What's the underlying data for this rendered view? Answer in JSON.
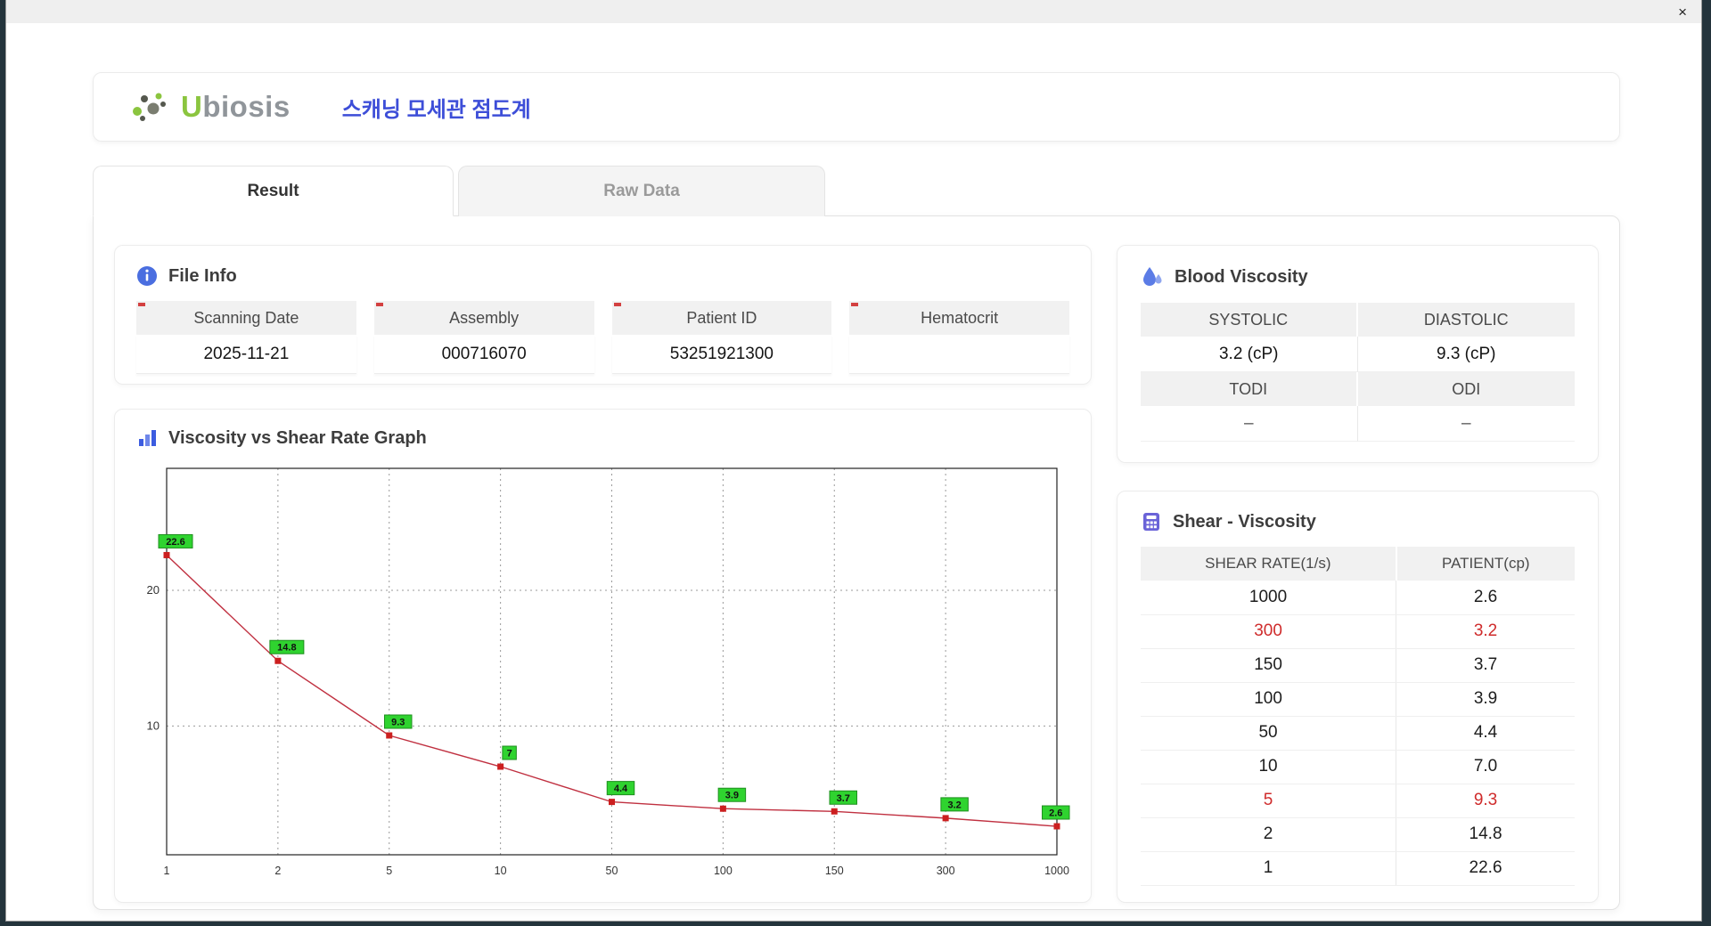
{
  "window": {
    "close_label": "×"
  },
  "header": {
    "logo_first": "U",
    "logo_rest": "biosis",
    "title": "스캐닝 모세관 점도계"
  },
  "tabs": [
    {
      "label": "Result",
      "active": true
    },
    {
      "label": "Raw Data",
      "active": false
    }
  ],
  "icons": {
    "logo": "dots-logo-icon",
    "close": "close-icon",
    "file_info": "info-icon",
    "graph": "bar-chart-icon",
    "blood": "droplet-icon",
    "shear": "calculator-icon"
  },
  "file_info": {
    "title": "File Info",
    "fields": [
      {
        "label": "Scanning Date",
        "value": "2025-11-21"
      },
      {
        "label": "Assembly",
        "value": "000716070"
      },
      {
        "label": "Patient ID",
        "value": "53251921300"
      },
      {
        "label": "Hematocrit",
        "value": ""
      }
    ]
  },
  "graph": {
    "title": "Viscosity vs Shear Rate Graph"
  },
  "chart_data": {
    "type": "line",
    "title": "Viscosity vs Shear Rate Graph",
    "x_scale": "categorical (log-spaced shear rates, evenly drawn)",
    "categories": [
      "1",
      "2",
      "5",
      "10",
      "50",
      "100",
      "150",
      "300",
      "1000"
    ],
    "values": [
      22.6,
      14.8,
      9.3,
      7,
      4.4,
      3.9,
      3.7,
      3.2,
      2.6
    ],
    "point_labels": [
      "22.6",
      "14.8",
      "9.3",
      "7",
      "4.4",
      "3.9",
      "3.7",
      "3.2",
      "2.6"
    ],
    "y_ticks": [
      10,
      20
    ],
    "ylim": [
      0.5,
      29
    ],
    "grid": "dashed",
    "legend": "none",
    "line_color": "#c03040",
    "marker_color": "#cc1f1f",
    "label_bg": "#2fd32f",
    "label_border": "#1f8f1f"
  },
  "blood_viscosity": {
    "title": "Blood Viscosity",
    "cells": [
      {
        "label": "SYSTOLIC",
        "value": "3.2 (cP)"
      },
      {
        "label": "DIASTOLIC",
        "value": "9.3 (cP)"
      },
      {
        "label": "TODI",
        "value": "–"
      },
      {
        "label": "ODI",
        "value": "–"
      }
    ]
  },
  "shear_table": {
    "title": "Shear - Viscosity",
    "columns": [
      "SHEAR RATE(1/s)",
      "PATIENT(cp)"
    ],
    "rows": [
      {
        "shear": "1000",
        "patient": "2.6",
        "highlight": false
      },
      {
        "shear": "300",
        "patient": "3.2",
        "highlight": true
      },
      {
        "shear": "150",
        "patient": "3.7",
        "highlight": false
      },
      {
        "shear": "100",
        "patient": "3.9",
        "highlight": false
      },
      {
        "shear": "50",
        "patient": "4.4",
        "highlight": false
      },
      {
        "shear": "10",
        "patient": "7.0",
        "highlight": false
      },
      {
        "shear": "5",
        "patient": "9.3",
        "highlight": true
      },
      {
        "shear": "2",
        "patient": "14.8",
        "highlight": false
      },
      {
        "shear": "1",
        "patient": "22.6",
        "highlight": false
      }
    ]
  },
  "colors": {
    "accent_blue": "#3d4ed8",
    "logo_green": "#8bc53f",
    "highlight_red": "#cf2b2b",
    "header_gray": "#f1f1f1"
  }
}
